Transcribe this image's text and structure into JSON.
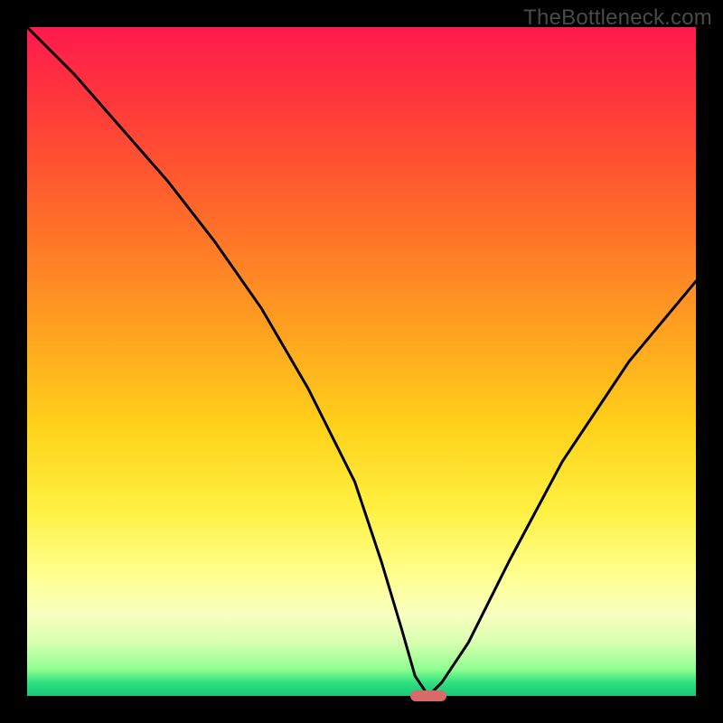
{
  "watermark": "TheBottleneck.com",
  "colors": {
    "frame": "#000000",
    "marker": "#d86a6a",
    "curve": "#000000"
  },
  "chart_data": {
    "type": "line",
    "title": "",
    "xlabel": "",
    "ylabel": "",
    "xlim": [
      0,
      100
    ],
    "ylim": [
      0,
      100
    ],
    "grid": false,
    "series": [
      {
        "name": "bottleneck-curve",
        "x": [
          0,
          7,
          14,
          21,
          28,
          35,
          42,
          49,
          53,
          56,
          58,
          60,
          62,
          66,
          72,
          80,
          90,
          100
        ],
        "values": [
          100,
          93,
          85,
          77,
          68,
          58,
          46,
          32,
          20,
          10,
          3,
          0,
          2,
          8,
          20,
          35,
          50,
          62
        ]
      }
    ],
    "marker": {
      "x": 60,
      "y": 0,
      "width_pct": 5.5,
      "height_pct": 1.6
    },
    "gradient_stops": [
      {
        "pct": 0,
        "color": "#ff1a4d"
      },
      {
        "pct": 12,
        "color": "#ff3a3a"
      },
      {
        "pct": 28,
        "color": "#ff6a2a"
      },
      {
        "pct": 45,
        "color": "#ffa020"
      },
      {
        "pct": 60,
        "color": "#ffd21a"
      },
      {
        "pct": 72,
        "color": "#fff040"
      },
      {
        "pct": 82,
        "color": "#ffff90"
      },
      {
        "pct": 88,
        "color": "#f8ffc0"
      },
      {
        "pct": 92,
        "color": "#d8ffb0"
      },
      {
        "pct": 96,
        "color": "#90ff90"
      },
      {
        "pct": 98,
        "color": "#30e080"
      },
      {
        "pct": 100,
        "color": "#18c878"
      }
    ]
  }
}
